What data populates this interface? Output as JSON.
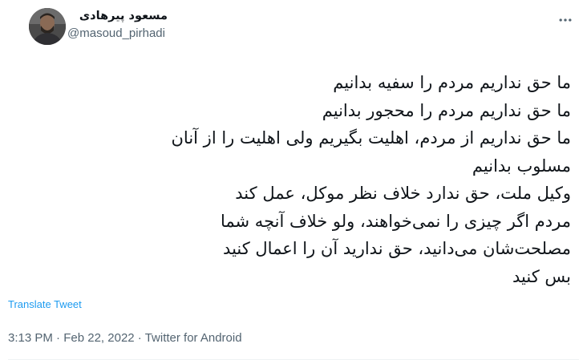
{
  "author": {
    "display_name": "مسعود پیرهادی",
    "handle": "@masoud_pirhadi",
    "avatar_icon": "profile-photo"
  },
  "more_icon": "more-horizontal-icon",
  "tweet": {
    "lines": [
      "ما حق نداریم مردم را سفیه بدانیم",
      "ما حق نداریم مردم را محجور بدانیم",
      "ما حق نداریم از مردم، اهلیت بگیریم ولی اهلیت را از آنان",
      "مسلوب بدانیم",
      "وکیل ملت، حق ندارد خلاف نظر موکل، عمل کند",
      "مردم اگر چیزی را نمی‌خواهند، ولو خلاف آنچه شما",
      "مصلحت‌شان می‌دانید، حق ندارید آن را اعمال کنید",
      "بس کنید"
    ]
  },
  "translate_label": "Translate Tweet",
  "meta": {
    "time": "3:13 PM",
    "separator": " · ",
    "date": "Feb 22, 2022",
    "source": "Twitter for Android"
  },
  "colors": {
    "text": "#0f1419",
    "secondary": "#536471",
    "link": "#1d9bf0"
  }
}
